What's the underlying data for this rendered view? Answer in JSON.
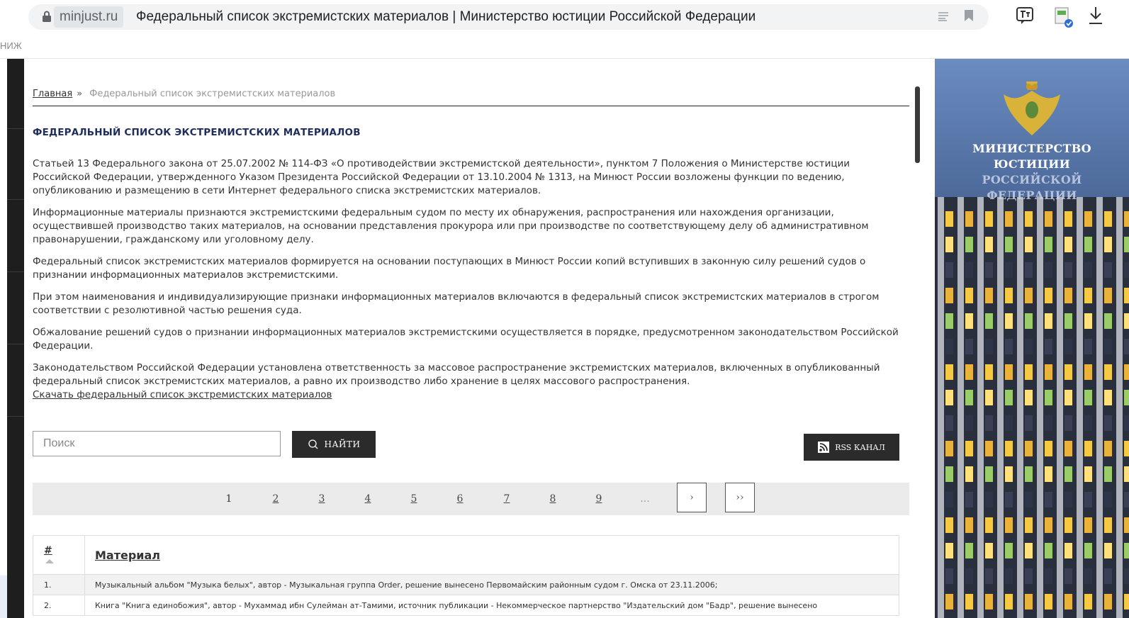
{
  "browser": {
    "domain": "minjust.ru",
    "title": "Федеральный список экстремистских материалов | Министерство юстиции Российской Федерации",
    "subbar_text": "НИЖ"
  },
  "breadcrumb": {
    "home": "Главная",
    "separator": "»",
    "current": "Федеральный список экстремистских материалов"
  },
  "heading": "ФЕДЕРАЛЬНЫЙ СПИСОК ЭКСТРЕМИСТСКИХ МАТЕРИАЛОВ",
  "paragraphs": [
    "Статьей 13 Федерального закона от 25.07.2002 № 114-ФЗ «О противодействии экстремистской деятельности», пунктом 7 Положения о Министерстве юстиции Российской Федерации, утвержденного Указом Президента Российской Федерации от 13.10.2004 № 1313, на Минюст России возложены функции по ведению, опубликованию и размещению в сети Интернет федерального списка экстремистских материалов.",
    "Информационные материалы признаются экстремистскими федеральным судом по месту их обнаружения, распространения или нахождения организации, осуществившей производство таких материалов, на основании представления прокурора или при производстве по соответствующему делу об административном правонарушении, гражданскому или уголовному делу.",
    "Федеральный список экстремистских материалов формируется на основании поступающих в Минюст России копий вступивших в законную силу решений судов о признании информационных материалов экстремистскими.",
    "При этом наименования и индивидуализирующие признаки информационных материалов включаются в федеральный список экстремистских материалов в строгом соответствии с резолютивной частью решения суда.",
    "Обжалование решений судов о признании информационных материалов экстремистскими осуществляется в порядке, предусмотренном законодательством Российской Федерации.",
    "Законодательством Российской Федерации установлена ответственность за массовое распространение экстремистских материалов, включенных в опубликованный федеральный список экстремистских материалов, а равно их производство либо хранение в целях массового распространения."
  ],
  "download_link": "Скачать федеральный список экстремистских материалов",
  "search": {
    "placeholder": "Поиск",
    "button": "НАЙТИ"
  },
  "rss_button": "RSS КАНАЛ",
  "pagination": {
    "pages": [
      "1",
      "2",
      "3",
      "4",
      "5",
      "6",
      "7",
      "8",
      "9"
    ],
    "current": "1",
    "ellipsis": "...",
    "next": "›",
    "last": "››"
  },
  "table": {
    "headers": {
      "number": "#",
      "material": "Материал"
    },
    "rows": [
      {
        "index": "1.",
        "text": "Музыкальный альбом \"Музыка белых\", автор - Музыкальная группа Order, решение вынесено Первомайским районным судом г. Омска от 23.11.2006;"
      },
      {
        "index": "2.",
        "text": "Книга \"Книга единобожия\", автор - Мухаммад ибн Сулейман ат-Тамими, источник публикации - Некоммерческое партнерство \"Издательский дом \"Бадр\", решение вынесено"
      }
    ]
  },
  "side_panel": {
    "lines": [
      "МИНИСТЕРСТВО",
      "ЮСТИЦИИ",
      "РОССИЙСКОЙ",
      "ФЕДЕРАЦИИ"
    ]
  },
  "icons": {
    "lock": "lock-icon",
    "reader": "reader-mode-icon",
    "bookmark": "bookmark-icon",
    "translate": "translate-icon",
    "extension": "extension-icon",
    "download": "download-icon",
    "search": "search-icon",
    "rss": "rss-icon",
    "emblem": "eagle-emblem-icon"
  },
  "colors": {
    "heading": "#1f2d5c",
    "button_bg": "#2b2b2b",
    "pager_bg": "#ebebeb",
    "side_panel_top": "#5f7fb4"
  }
}
